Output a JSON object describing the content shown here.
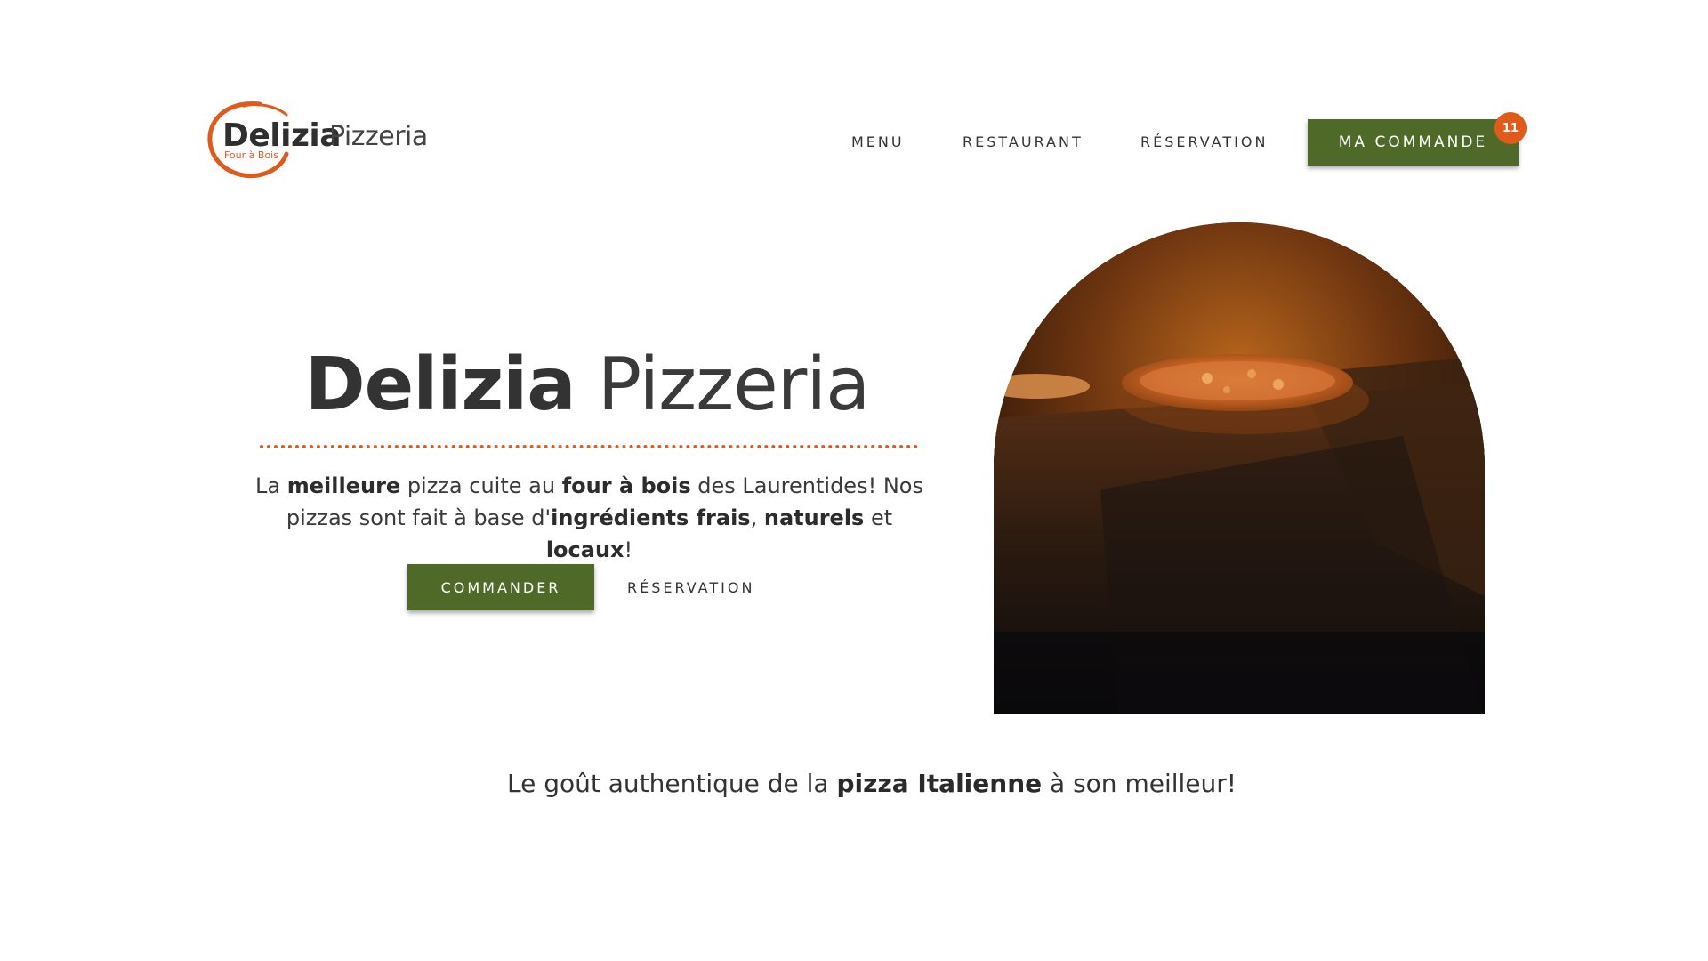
{
  "brand": {
    "name_bold": "Delizia",
    "name_light": "Pizzeria",
    "subtitle": "Four à Bois",
    "accent_color": "#e05a1c",
    "primary_color": "#4f6a28"
  },
  "nav": {
    "menu": "MENU",
    "restaurant": "RESTAURANT",
    "reservation": "RÉSERVATION",
    "order_button": "MA COMMANDE",
    "order_count": "11"
  },
  "hero": {
    "title_bold": "Delizia",
    "title_light": "Pizzeria",
    "desc": {
      "t1": "La ",
      "b1": "meilleure",
      "t2": " pizza cuite au ",
      "b2": "four à bois",
      "t3": " des Laurentides! Nos pizzas sont fait à base d'",
      "b3": "ingrédients frais",
      "t4": ", ",
      "b4": "naturels",
      "t5": " et ",
      "b5": "locaux",
      "t6": "!"
    },
    "cta_order": "COMMANDER",
    "cta_reservation": "RÉSERVATION",
    "image_icon": "wood-fired-oven-pizza-image"
  },
  "tagline": {
    "t1": "Le goût authentique de la ",
    "b1": "pizza Italienne",
    "t2": " à son meilleur!"
  }
}
